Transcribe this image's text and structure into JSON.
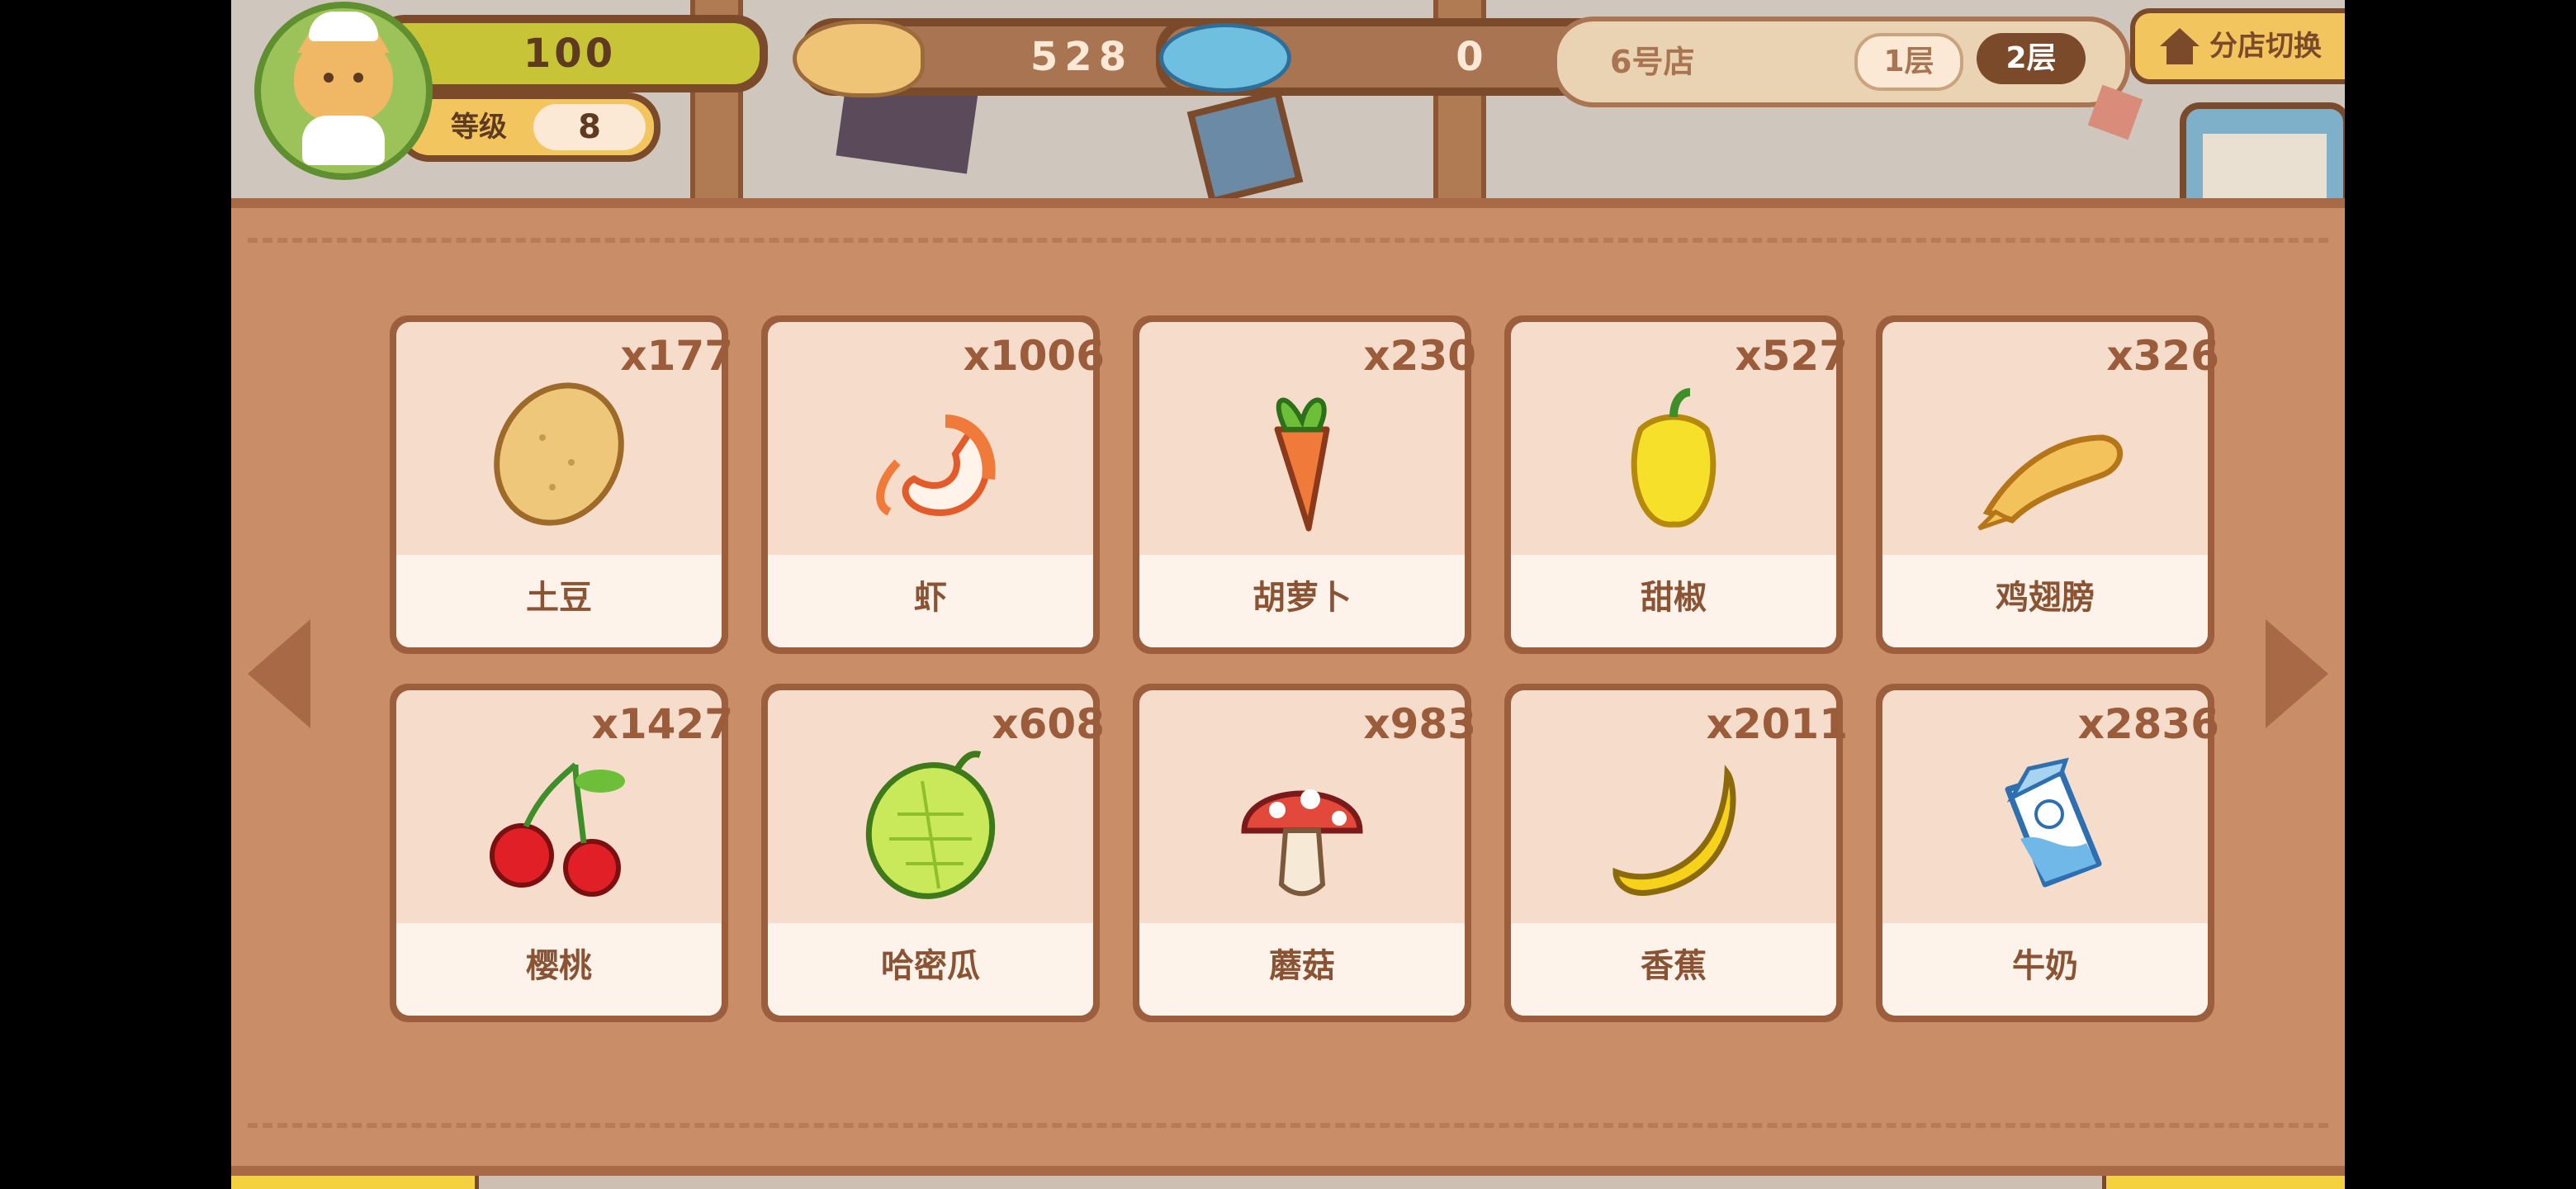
{
  "hud": {
    "level_bar_value": "100",
    "level_label": "等级",
    "level_value": "8",
    "coin_value": "528",
    "fish_value": "0"
  },
  "store": {
    "name": "6号店",
    "floors": [
      "1层",
      "2层"
    ],
    "active_floor": "2层",
    "branch_switch_label": "分店切换"
  },
  "inventory": {
    "items": [
      {
        "name": "土豆",
        "count": "x177",
        "icon": "potato-icon"
      },
      {
        "name": "虾",
        "count": "x1006",
        "icon": "shrimp-icon"
      },
      {
        "name": "胡萝卜",
        "count": "x230",
        "icon": "carrot-icon"
      },
      {
        "name": "甜椒",
        "count": "x527",
        "icon": "bell-pepper-icon"
      },
      {
        "name": "鸡翅膀",
        "count": "x326",
        "icon": "chicken-wing-icon"
      },
      {
        "name": "樱桃",
        "count": "x1427",
        "icon": "cherry-icon"
      },
      {
        "name": "哈密瓜",
        "count": "x608",
        "icon": "melon-icon"
      },
      {
        "name": "蘑菇",
        "count": "x983",
        "icon": "mushroom-icon"
      },
      {
        "name": "香蕉",
        "count": "x2011",
        "icon": "banana-icon"
      },
      {
        "name": "牛奶",
        "count": "x2836",
        "icon": "milk-icon"
      }
    ]
  },
  "colors": {
    "panel": "#c98e68",
    "card_border": "#9d5e3e",
    "card_bg": "#f6dccb",
    "label_bg": "#fdf3ea",
    "text_brown": "#8a5434",
    "accent_yellow": "#f4d23f"
  }
}
